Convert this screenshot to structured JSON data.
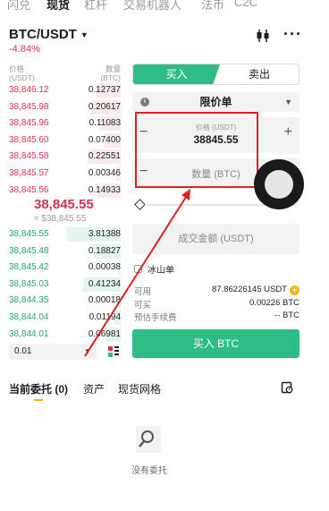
{
  "top_tabs": [
    "闪兑",
    "现货",
    "杠杆",
    "交易机器人",
    "法币",
    "C2C"
  ],
  "pair": {
    "name": "BTC/USDT",
    "change": "-4.84%"
  },
  "orderbook": {
    "price_header": [
      "价格",
      "(USDT)"
    ],
    "qty_header": [
      "数量",
      "(BTC)"
    ],
    "asks": [
      {
        "price": "38,846.12",
        "qty": "0.12737",
        "depth": 0.45
      },
      {
        "price": "38,845.98",
        "qty": "0.20617",
        "depth": 0.55
      },
      {
        "price": "38,845.96",
        "qty": "0.11083",
        "depth": 0.4
      },
      {
        "price": "38,845.60",
        "qty": "0.07400",
        "depth": 0.3
      },
      {
        "price": "38,845.58",
        "qty": "0.22551",
        "depth": 0.6
      },
      {
        "price": "38,845.57",
        "qty": "0.00346",
        "depth": 0.08
      },
      {
        "price": "38,845.56",
        "qty": "0.14933",
        "depth": 0.45
      }
    ],
    "last_price": "38,845.55",
    "last_price_fiat": "≈ $38,845.55",
    "bids": [
      {
        "price": "38,845.55",
        "qty": "3.81388",
        "depth": 1.0
      },
      {
        "price": "38,845.48",
        "qty": "0.18827",
        "depth": 0.5
      },
      {
        "price": "38,845.42",
        "qty": "0.00038",
        "depth": 0.05
      },
      {
        "price": "38,845.03",
        "qty": "0.41234",
        "depth": 0.7
      },
      {
        "price": "38,844.35",
        "qty": "0.00018",
        "depth": 0.05
      },
      {
        "price": "38,844.04",
        "qty": "0.01194",
        "depth": 0.12
      },
      {
        "price": "38,844.01",
        "qty": "0.06981",
        "depth": 0.3
      }
    ],
    "depth_value": "0.01"
  },
  "order_form": {
    "buy_tab": "买入",
    "sell_tab": "卖出",
    "order_type": "限价单",
    "price_label": "价格 (USDT)",
    "price_value": "38845.55",
    "qty_placeholder": "数量 (BTC)",
    "total_placeholder": "成交金额 (USDT)",
    "iceberg_label": "冰山单",
    "available_label": "可用",
    "available_value": "87.86226145 USDT",
    "can_buy_label": "可买",
    "can_buy_value": "0.00226 BTC",
    "fee_label": "预估手续费",
    "fee_value": "-- BTC",
    "submit_label": "买入 BTC"
  },
  "bottom": {
    "tab_open_orders": "当前委托 (0)",
    "tab_assets": "资产",
    "tab_grid": "现货网格",
    "empty_text": "没有委托"
  },
  "colors": {
    "buy": "#2ebd86",
    "sell": "#d6334f",
    "highlight": "#e02020"
  }
}
